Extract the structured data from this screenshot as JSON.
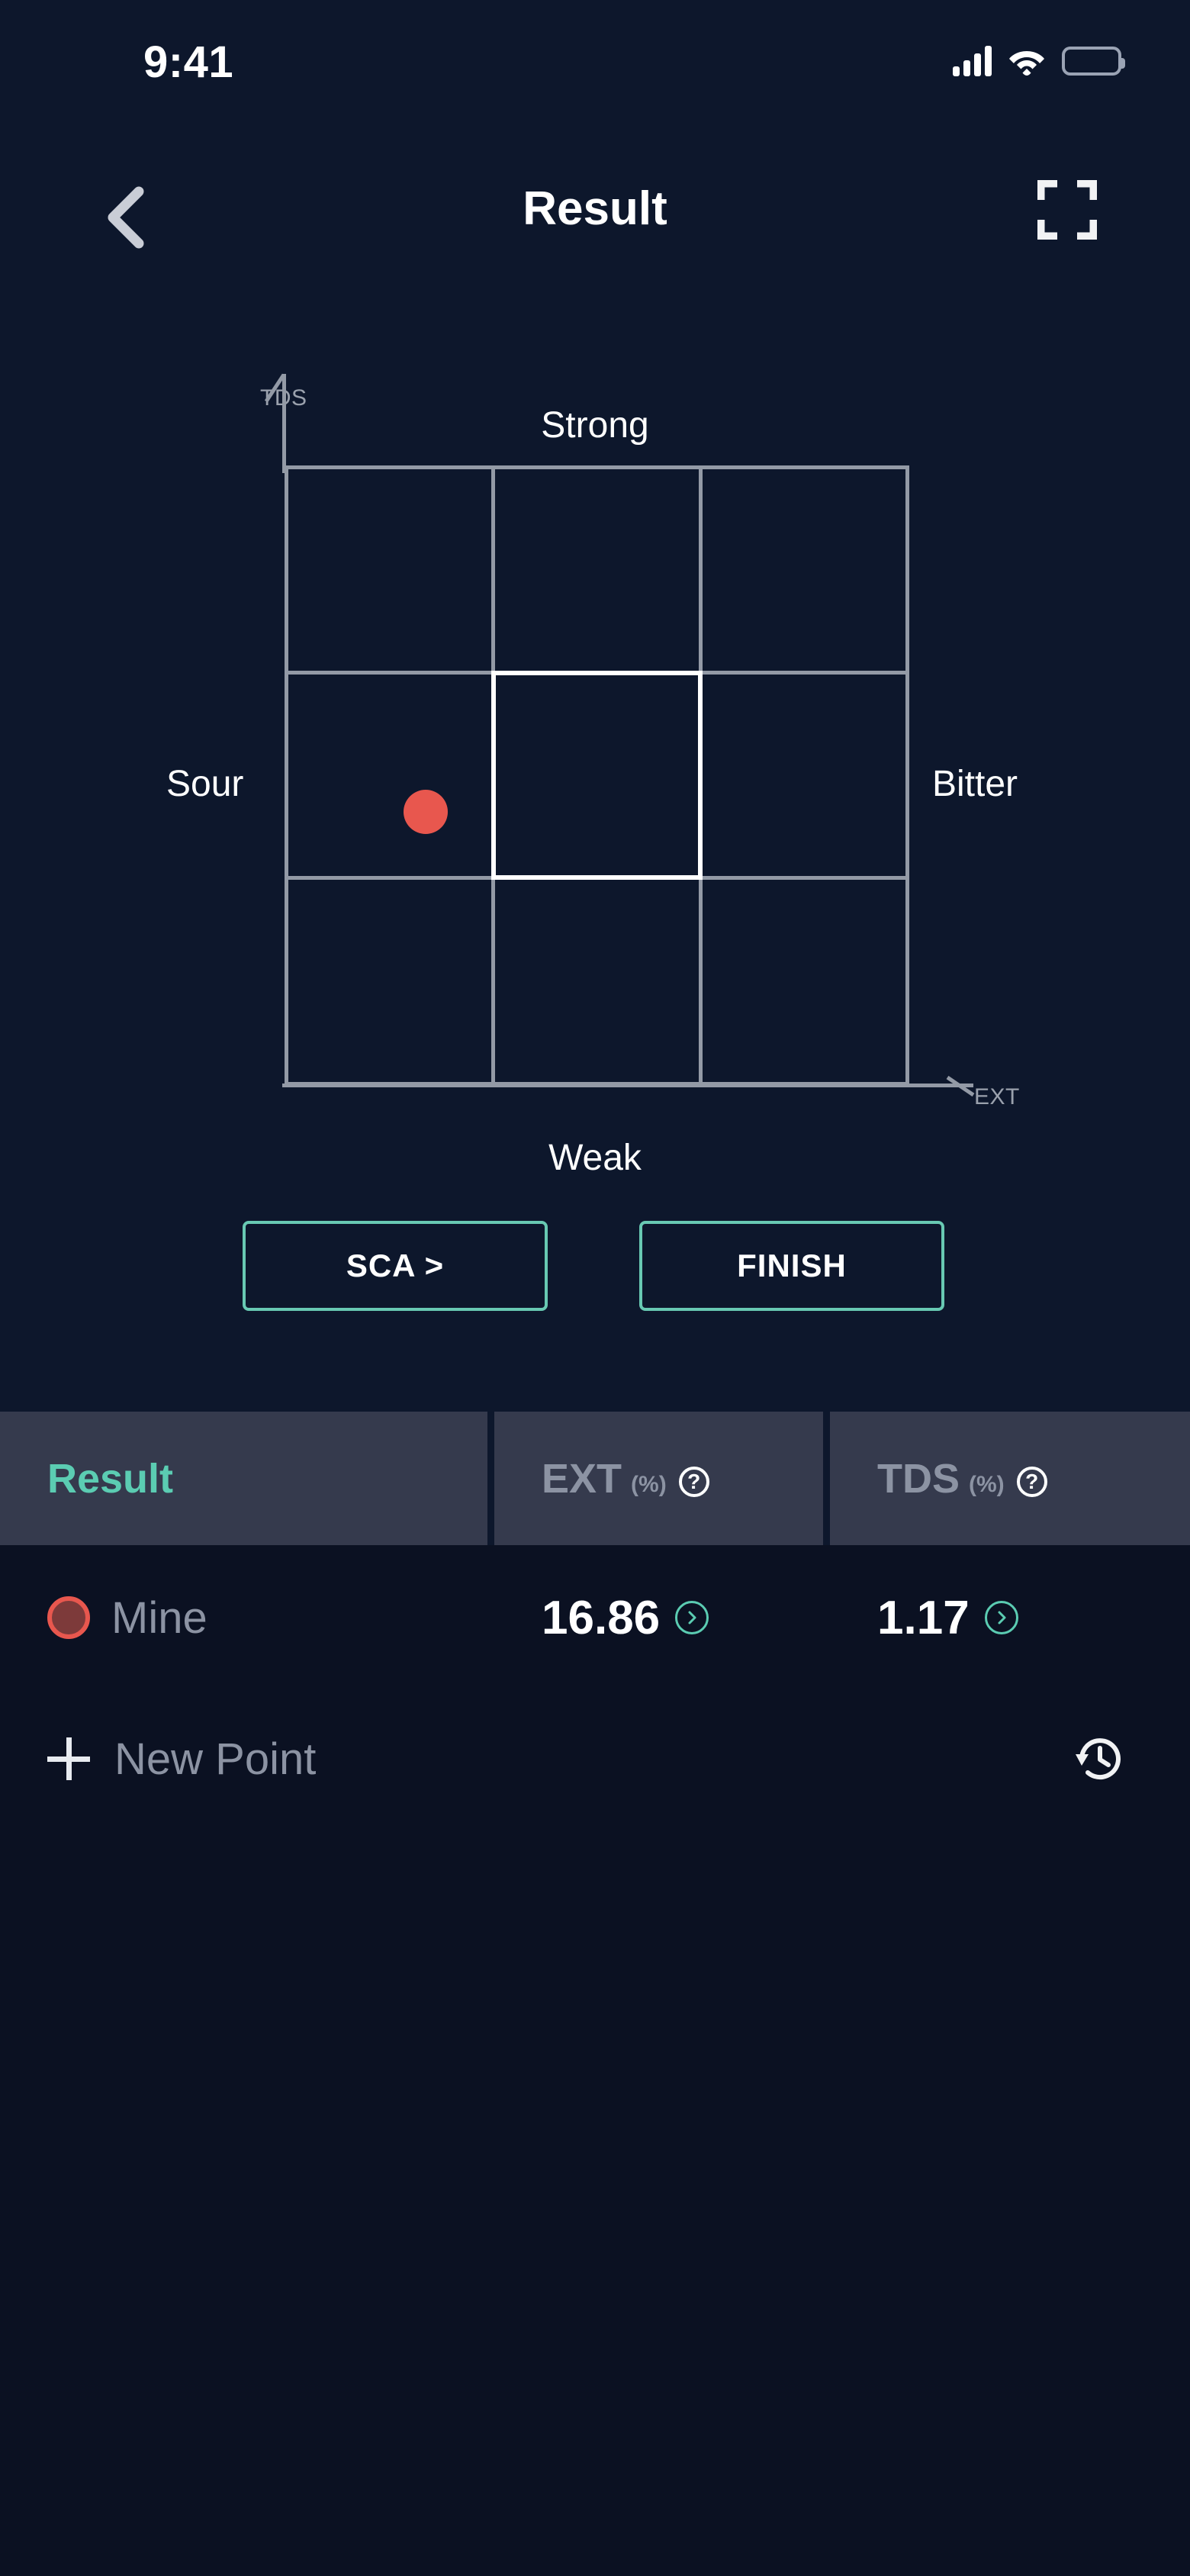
{
  "status_bar": {
    "time": "9:41",
    "signal_icon": "cellular-signal-icon",
    "wifi_icon": "wifi-icon",
    "battery_icon": "battery-icon"
  },
  "nav": {
    "back_icon": "chevron-left-icon",
    "title": "Result",
    "expand_icon": "fullscreen-expand-icon"
  },
  "chart_data": {
    "type": "scatter",
    "title": "Result",
    "xlabel": "EXT",
    "ylabel": "TDS",
    "axis_corner_labels": {
      "y_axis": "TDS",
      "x_axis": "EXT"
    },
    "edge_labels": {
      "top": "Strong",
      "bottom": "Weak",
      "left": "Sour",
      "right": "Bitter"
    },
    "grid": {
      "rows": 3,
      "cols": 3,
      "visible": true
    },
    "highlighted_cell": {
      "row": 1,
      "col": 1,
      "label": "ideal-zone"
    },
    "points": [
      {
        "name": "Mine",
        "ext": 16.86,
        "tds": 1.17,
        "color": "#e8574e",
        "x_pct": 22.5,
        "y_pct": 56.0
      }
    ],
    "xlim": [
      0,
      100
    ],
    "ylim": [
      0,
      100
    ],
    "legend_position": "none"
  },
  "actions": {
    "sca_label": "SCA >",
    "finish_label": "FINISH",
    "accent_color": "#68c9b3"
  },
  "table": {
    "columns": [
      {
        "main": "Result",
        "unit": "",
        "help": "",
        "accent": true
      },
      {
        "main": "EXT",
        "unit": "(%)",
        "help": "?",
        "accent": false
      },
      {
        "main": "TDS",
        "unit": "(%)",
        "help": "?",
        "accent": false
      }
    ],
    "rows": [
      {
        "name": "Mine",
        "dot_color": "#e8574e",
        "ext": "16.86",
        "tds": "1.17",
        "chevron_icon": "chevron-right-circle-icon"
      }
    ],
    "new_point": {
      "plus_icon": "plus-icon",
      "label": "New Point",
      "history_icon": "history-clock-icon"
    }
  },
  "theme": {
    "background": "#0b1122",
    "panel_background": "#0d172c",
    "table_header_background": "#353a4d",
    "accent_teal": "#5bccb2",
    "accent_red": "#e8574e",
    "grid_line": "#939aa6",
    "muted_text": "#8c93a3"
  }
}
